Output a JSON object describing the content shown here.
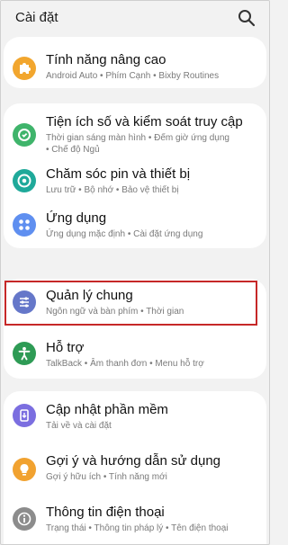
{
  "header": {
    "title": "Cài đặt",
    "search_icon": "search-icon"
  },
  "colors": {
    "advanced": "#f2a62e",
    "digital": "#3fb46b",
    "battery": "#1fa99a",
    "apps": "#5f8ff0",
    "general": "#6577c9",
    "help": "#2e9b55",
    "update": "#7b6ee0",
    "tips": "#f1a230",
    "about": "#8c8c8c"
  },
  "items": [
    {
      "label": "Tính năng nâng cao",
      "sub": "Android Auto  •  Phím Cạnh  •  Bixby Routines",
      "icon": "puzzle-icon"
    },
    {
      "label": "Tiện ích số và kiểm soát truy cập",
      "sub": "Thời gian sáng màn hình  •  Đếm giờ ứng dụng",
      "sub2": "•  Chế độ Ngủ",
      "icon": "digital-wellbeing-icon"
    },
    {
      "label": "Chăm sóc pin và thiết bị",
      "sub": "Lưu trữ  •  Bộ nhớ  •  Bảo vệ thiết bị",
      "icon": "device-care-icon"
    },
    {
      "label": "Ứng dụng",
      "sub": "Ứng dụng mặc định  •  Cài đặt ứng dụng",
      "icon": "apps-icon"
    },
    {
      "label": "Quản lý chung",
      "sub": "Ngôn ngữ và bàn phím  •  Thời gian",
      "icon": "sliders-icon"
    },
    {
      "label": "Hỗ trợ",
      "sub": "TalkBack  •  Âm thanh đơn  •  Menu hỗ trợ",
      "icon": "accessibility-icon"
    },
    {
      "label": "Cập nhật phần mềm",
      "sub": "Tải về và cài đặt",
      "icon": "software-update-icon"
    },
    {
      "label": "Gợi ý và hướng dẫn sử dụng",
      "sub": "Gợi ý hữu ích  •  Tính năng mới",
      "icon": "tips-icon"
    },
    {
      "label": "Thông tin điện thoại",
      "sub": "Trạng thái  •  Thông tin pháp lý  •  Tên điện thoại",
      "icon": "info-icon"
    }
  ]
}
